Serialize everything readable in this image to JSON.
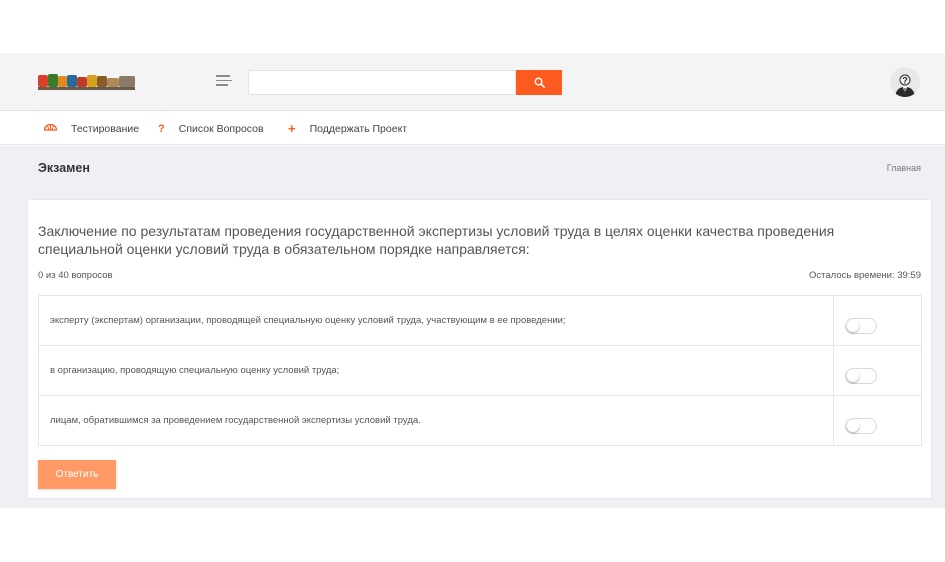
{
  "header": {
    "search_placeholder": "",
    "icons": {
      "menu": "hamburger-icon",
      "search": "search-icon",
      "avatar": "user-avatar"
    }
  },
  "nav": {
    "items": [
      {
        "label": "Тестирование",
        "icon": "umbrella-icon"
      },
      {
        "label": "Список Вопросов",
        "icon": "question-mark-icon"
      },
      {
        "label": "Поддержать Проект",
        "icon": "plus-icon"
      }
    ]
  },
  "page": {
    "title": "Экзамен",
    "breadcrumb": "Главная"
  },
  "quiz": {
    "question": "Заключение по результатам проведения государственной экспертизы условий труда в целях оценки качества проведения специальной оценки условий труда в обязательном порядке направляется:",
    "progress": "0 из 40 вопросов",
    "timer": "Осталось времени: 39:59",
    "answers": [
      {
        "text": "эксперту (экспертам) организации, проводящей специальную оценку условий труда, участвующим в ее проведении;",
        "selected": false
      },
      {
        "text": "в организацию, проводящую специальную оценку условий труда;",
        "selected": false
      },
      {
        "text": "лицам, обратившимся за проведением государственной экспертизы условий труда.",
        "selected": false
      }
    ],
    "submit_label": "Ответить"
  },
  "colors": {
    "accent": "#fd5a20",
    "submit": "#ff9966",
    "page_bg": "#eef0f4"
  }
}
